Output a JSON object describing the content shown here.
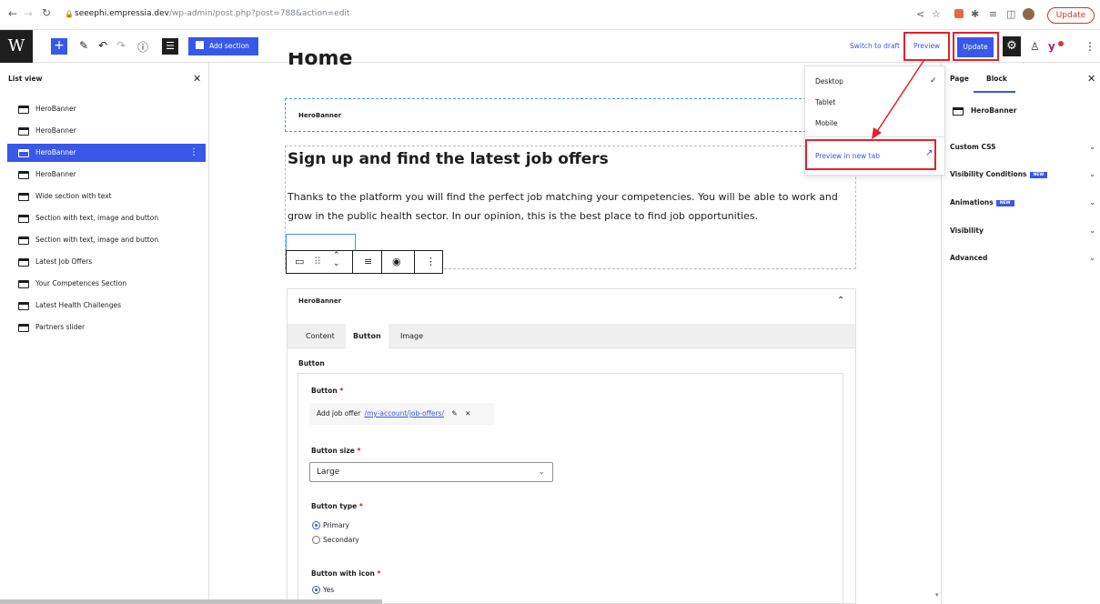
{
  "browser": {
    "url_host": "seeephi.empressia.dev",
    "url_path": "/wp-admin/post.php?post=788&action=edit",
    "update_label": "Update"
  },
  "toolbar": {
    "add_section_label": "Add section",
    "switch_to_draft_label": "Switch to draft",
    "preview_label": "Preview",
    "update_label": "Update"
  },
  "list_view": {
    "title": "List view",
    "items": [
      {
        "label": "HeroBanner",
        "selected": false
      },
      {
        "label": "HeroBanner",
        "selected": false
      },
      {
        "label": "HeroBanner",
        "selected": true
      },
      {
        "label": "HeroBanner",
        "selected": false
      },
      {
        "label": "Wide section with text",
        "selected": false
      },
      {
        "label": "Section with text, image and button",
        "selected": false
      },
      {
        "label": "Section with text, image and button",
        "selected": false
      },
      {
        "label": "Latest Job Offers",
        "selected": false
      },
      {
        "label": "Your Competences Section",
        "selected": false
      },
      {
        "label": "Latest Health Challenges",
        "selected": false
      },
      {
        "label": "Partners slider",
        "selected": false
      }
    ]
  },
  "canvas": {
    "page_title": "Home",
    "first_block_label": "HeroBanner",
    "heading": "Sign up and find the latest job offers",
    "paragraph": "Thanks to the platform you will find the perfect job matching your competencies. You will be able to work and grow in the public health sector. In our opinion, this is the best place to find job opportunities.",
    "panel": {
      "title": "HeroBanner",
      "tabs": [
        "Content",
        "Button",
        "Image"
      ],
      "active_tab": "Button",
      "section_label": "Button",
      "button_field_label": "Button",
      "button_text": "Add job offer",
      "button_url": "/my-account/job-offers/",
      "size_label": "Button size",
      "size_value": "Large",
      "type_label": "Button type",
      "type_options": [
        "Primary",
        "Secondary"
      ],
      "type_selected": "Primary",
      "icon_label": "Button with icon",
      "icon_options": [
        "Yes"
      ],
      "icon_selected": "Yes"
    }
  },
  "settings": {
    "tab_page": "Page",
    "tab_block": "Block",
    "block_name": "HeroBanner",
    "rows": [
      {
        "label": "Custom CSS",
        "badge": ""
      },
      {
        "label": "Visibility Conditions",
        "badge": "NEW"
      },
      {
        "label": "Animations",
        "badge": "NEW"
      },
      {
        "label": "Visibility",
        "badge": ""
      },
      {
        "label": "Advanced",
        "badge": ""
      }
    ]
  },
  "preview_menu": {
    "items": [
      "Desktop",
      "Tablet",
      "Mobile"
    ],
    "checked": "Desktop",
    "new_tab_label": "Preview in new tab"
  },
  "colors": {
    "accent": "#3858e9",
    "highlight": "#e8202a",
    "dark": "#1e1e1e"
  }
}
